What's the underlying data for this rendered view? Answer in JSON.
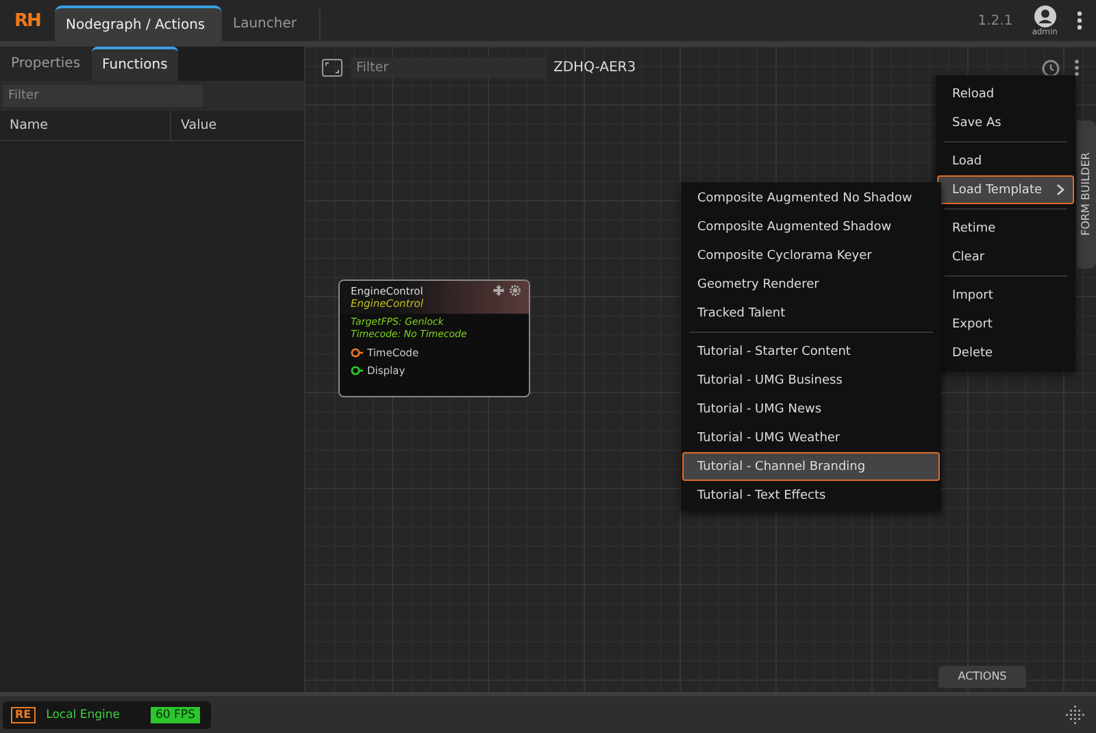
{
  "app": {
    "logo": "RH",
    "version": "1.2.1",
    "user": "admin"
  },
  "tabs": [
    {
      "label": "Nodegraph / Actions",
      "selected": true
    },
    {
      "label": "Launcher",
      "selected": false
    }
  ],
  "left_panel": {
    "tabs": [
      {
        "label": "Properties",
        "selected": false
      },
      {
        "label": "Functions",
        "selected": true
      }
    ],
    "filter": {
      "placeholder": "Filter"
    },
    "columns": [
      "Name",
      "Value"
    ]
  },
  "canvas": {
    "filter": {
      "placeholder": "Filter"
    },
    "title": "ZDHQ-AER3",
    "node": {
      "title": "EngineControl",
      "subtitle": "EngineControl",
      "info": [
        "TargetFPS: Genlock",
        "Timecode: No Timecode"
      ],
      "ports": [
        {
          "label": "TimeCode",
          "color": "#e87722"
        },
        {
          "label": "Display",
          "color": "#2ec82e"
        }
      ]
    },
    "side_tab": "FORM BUILDER",
    "bottom_tab": "ACTIONS"
  },
  "menu": {
    "groups": [
      [
        {
          "label": "Reload",
          "selected": false,
          "submenu": false
        },
        {
          "label": "Save As",
          "selected": false,
          "submenu": false
        }
      ],
      [
        {
          "label": "Load",
          "selected": false,
          "submenu": false
        },
        {
          "label": "Load Template",
          "selected": true,
          "submenu": true
        }
      ],
      [
        {
          "label": "Retime",
          "selected": false,
          "submenu": false
        },
        {
          "label": "Clear",
          "selected": false,
          "submenu": false
        }
      ],
      [
        {
          "label": "Import",
          "selected": false,
          "submenu": false
        },
        {
          "label": "Export",
          "selected": false,
          "submenu": false
        },
        {
          "label": "Delete",
          "selected": false,
          "submenu": false
        }
      ]
    ]
  },
  "submenu": {
    "groups": [
      [
        {
          "label": "Composite Augmented No Shadow",
          "selected": false
        },
        {
          "label": "Composite Augmented Shadow",
          "selected": false
        },
        {
          "label": "Composite Cyclorama Keyer",
          "selected": false
        },
        {
          "label": "Geometry Renderer",
          "selected": false
        },
        {
          "label": "Tracked Talent",
          "selected": false
        }
      ],
      [
        {
          "label": "Tutorial - Starter Content",
          "selected": false
        },
        {
          "label": "Tutorial - UMG Business",
          "selected": false
        },
        {
          "label": "Tutorial - UMG News",
          "selected": false
        },
        {
          "label": "Tutorial - UMG Weather",
          "selected": false
        },
        {
          "label": "Tutorial - Channel Branding",
          "selected": true
        },
        {
          "label": "Tutorial - Text Effects",
          "selected": false
        }
      ]
    ]
  },
  "status_bar": {
    "logo": "RE",
    "engine": "Local Engine",
    "fps": "60 FPS"
  }
}
